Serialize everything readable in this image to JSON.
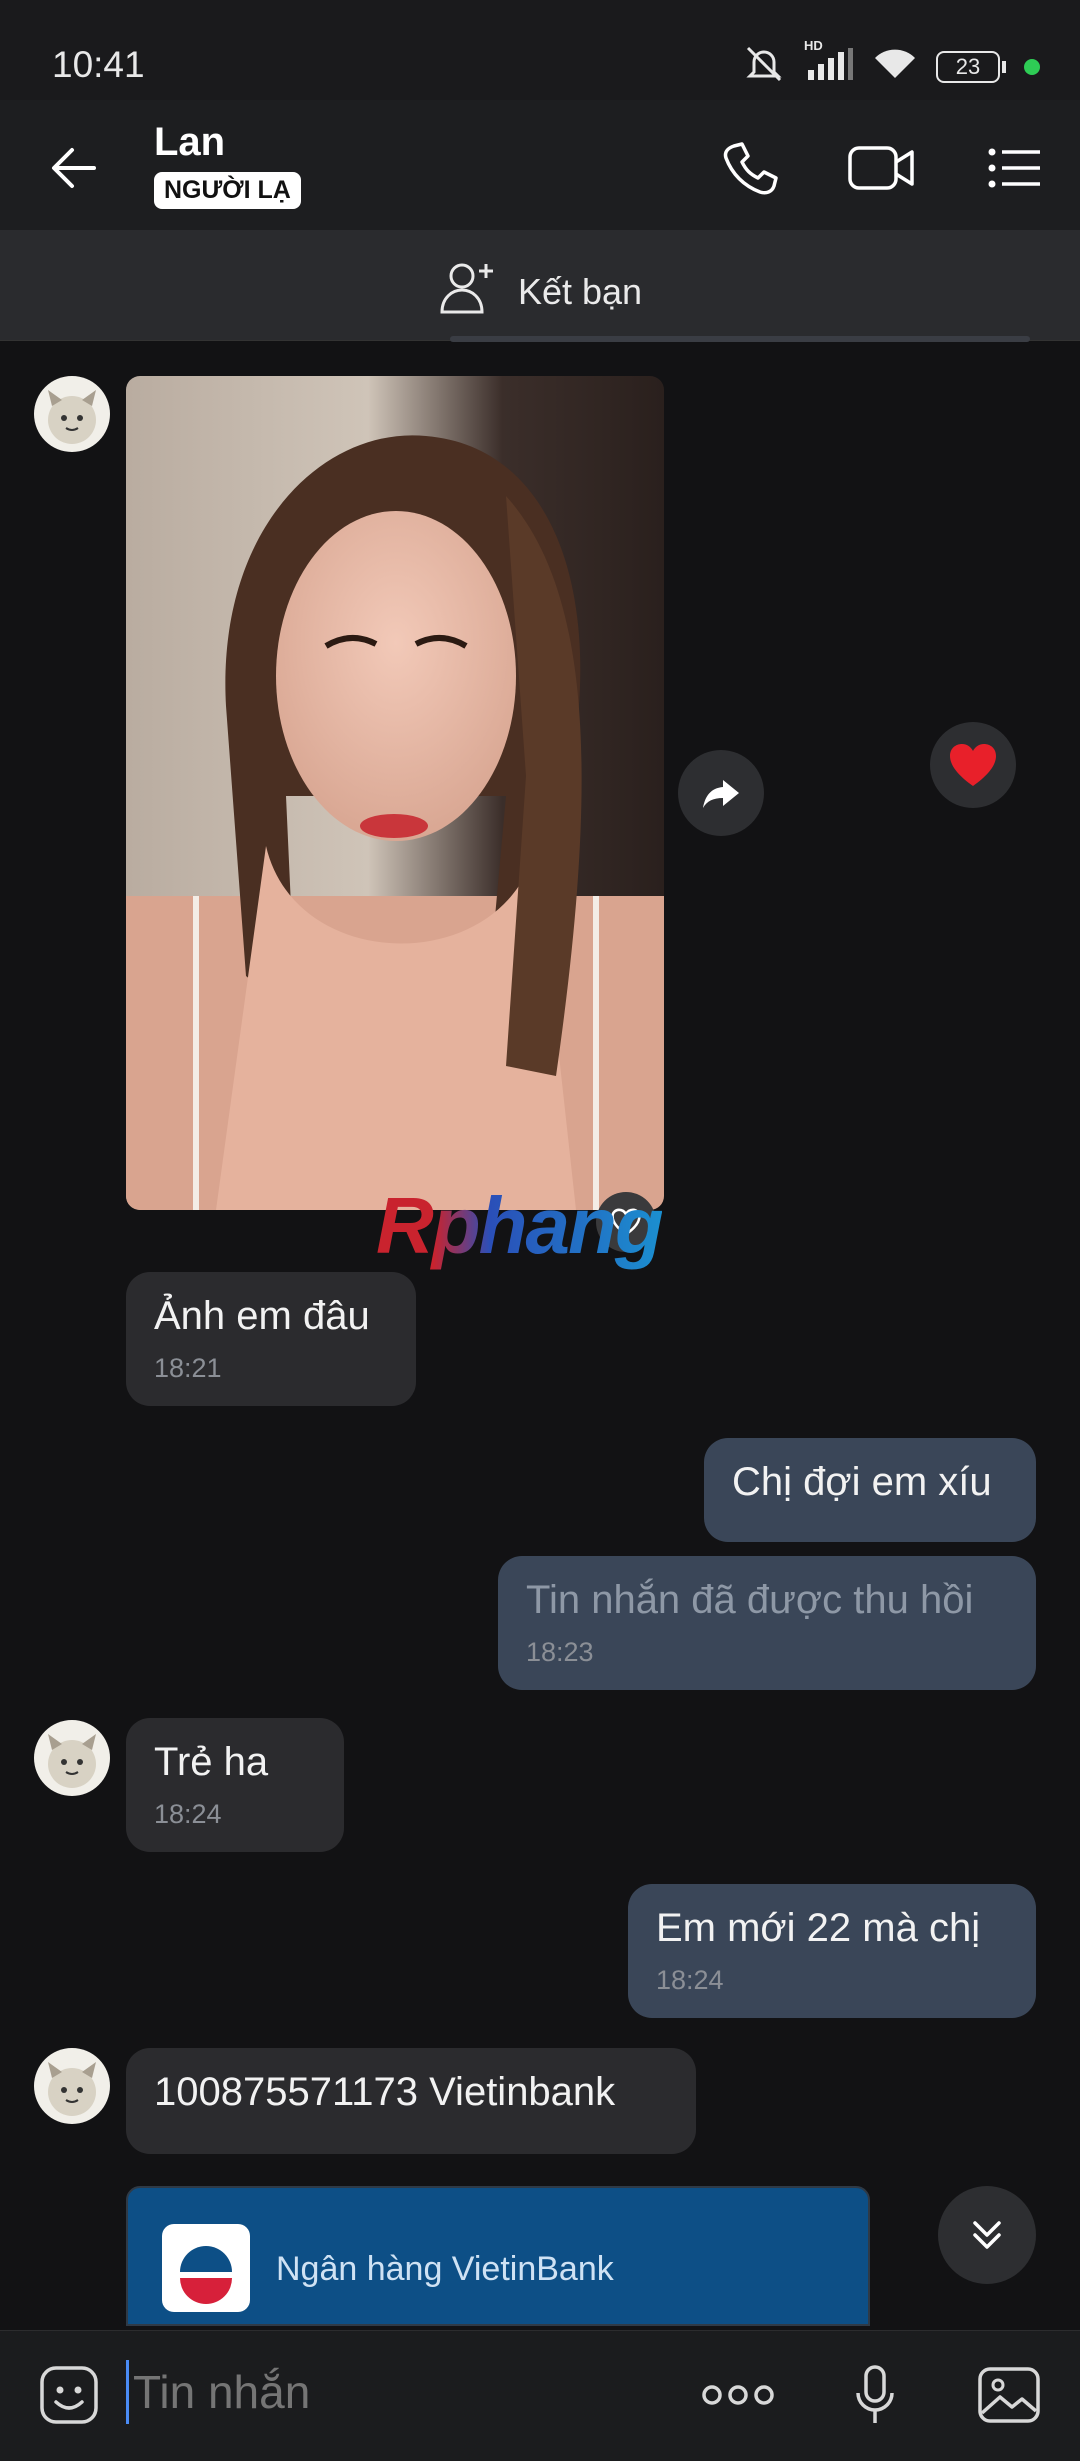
{
  "status_bar": {
    "time": "10:41",
    "battery": "23",
    "network_badge": "HD",
    "icons": [
      "mute-icon",
      "signal-icon",
      "wifi-icon",
      "battery-icon",
      "dot-icon"
    ]
  },
  "header": {
    "contact_name": "Lan",
    "badge": "NGƯỜI LẠ",
    "actions": [
      "call-icon",
      "video-call-icon",
      "menu-list-icon"
    ]
  },
  "add_friend_bar": {
    "label": "Kết bạn",
    "icon": "add-friend-icon"
  },
  "watermark": "Rphang",
  "messages": [
    {
      "direction": "incoming",
      "type": "image",
      "alt": "photo"
    },
    {
      "direction": "incoming",
      "text": "Ảnh em đâu",
      "time": "18:21"
    },
    {
      "direction": "outgoing",
      "text": "Chị đợi em xíu"
    },
    {
      "direction": "outgoing",
      "text": "Tin nhắn đã được thu hồi",
      "time": "18:23",
      "recalled": true
    },
    {
      "direction": "incoming",
      "text": "Trẻ ha",
      "time": "18:24"
    },
    {
      "direction": "outgoing",
      "text": "Em mới 22 mà chị",
      "time": "18:24"
    },
    {
      "direction": "incoming",
      "text": "100875571173 Vietinbank"
    },
    {
      "direction": "incoming",
      "type": "bank_card",
      "bank_name": "Ngân hàng VietinBank"
    }
  ],
  "composer": {
    "placeholder": "Tin nhắn",
    "icons": [
      "sticker-icon",
      "more-icon",
      "microphone-icon",
      "image-icon"
    ]
  },
  "colors": {
    "background": "#121214",
    "incoming_bubble": "#2b2b2e",
    "outgoing_bubble": "#3a4658",
    "heart": "#e8202a",
    "bank_card": "#0d4f86"
  }
}
